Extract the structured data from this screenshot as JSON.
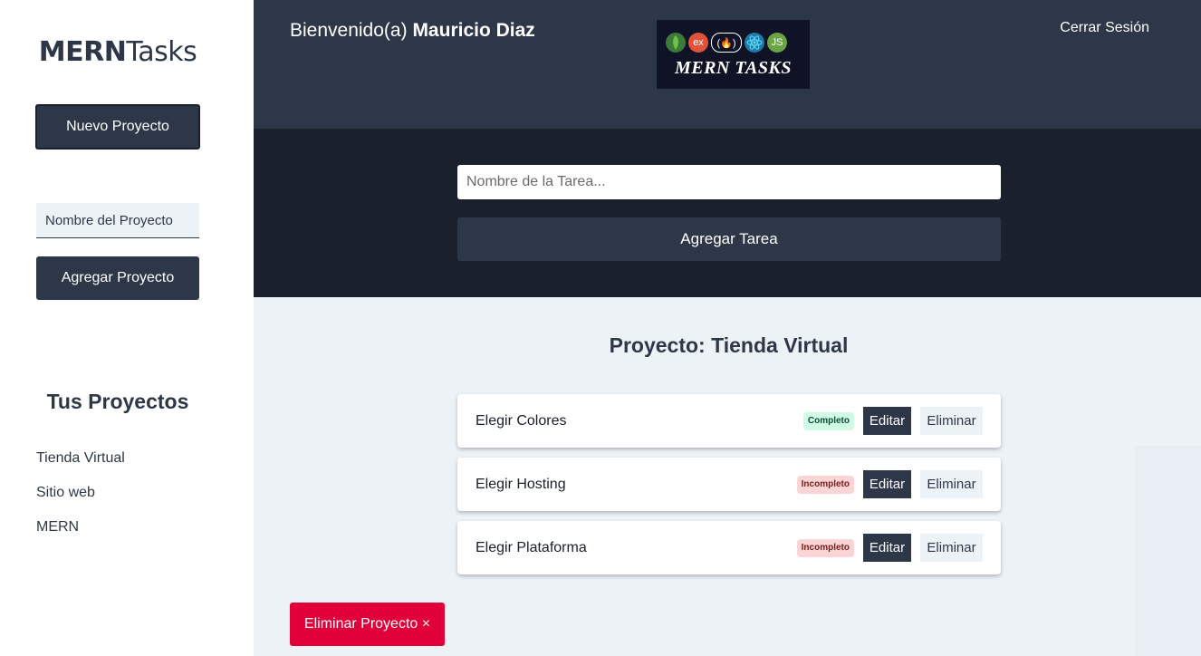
{
  "sidebar": {
    "brand_bold": "MERN",
    "brand_light": "Tasks",
    "new_project_label": "Nuevo Proyecto",
    "project_name_placeholder": "Nombre del Proyecto",
    "add_project_label": "Agregar Proyecto",
    "your_projects_title": "Tus Proyectos",
    "projects": [
      {
        "label": "Tienda Virtual"
      },
      {
        "label": "Sitio web"
      },
      {
        "label": "MERN"
      }
    ]
  },
  "header": {
    "welcome_prefix": "Bienvenido(a)",
    "user_name": "Mauricio Diaz",
    "logo_text": "MERN TASKS",
    "logout_label": "Cerrar Sesión"
  },
  "task_form": {
    "task_name_placeholder": "Nombre de la Tarea...",
    "add_task_label": "Agregar Tarea"
  },
  "project": {
    "title": "Proyecto: Tienda Virtual",
    "tasks": [
      {
        "name": "Elegir Colores",
        "status": "Completo",
        "edit_label": "Editar",
        "delete_label": "Eliminar"
      },
      {
        "name": "Elegir Hosting",
        "status": "Incompleto",
        "edit_label": "Editar",
        "delete_label": "Eliminar"
      },
      {
        "name": "Elegir Plataforma",
        "status": "Incompleto",
        "edit_label": "Editar",
        "delete_label": "Eliminar"
      }
    ],
    "delete_project_label": "Eliminar Proyecto ×"
  },
  "colors": {
    "primary": "#2d3748",
    "dark": "#1a202c",
    "danger": "#e2003b",
    "complete_badge": "#d1fae5",
    "incomplete_badge": "#fbd5d5"
  },
  "icons": [
    "mongodb-icon",
    "express-icon",
    "freecodecamp-icon",
    "react-icon",
    "nodejs-icon"
  ]
}
